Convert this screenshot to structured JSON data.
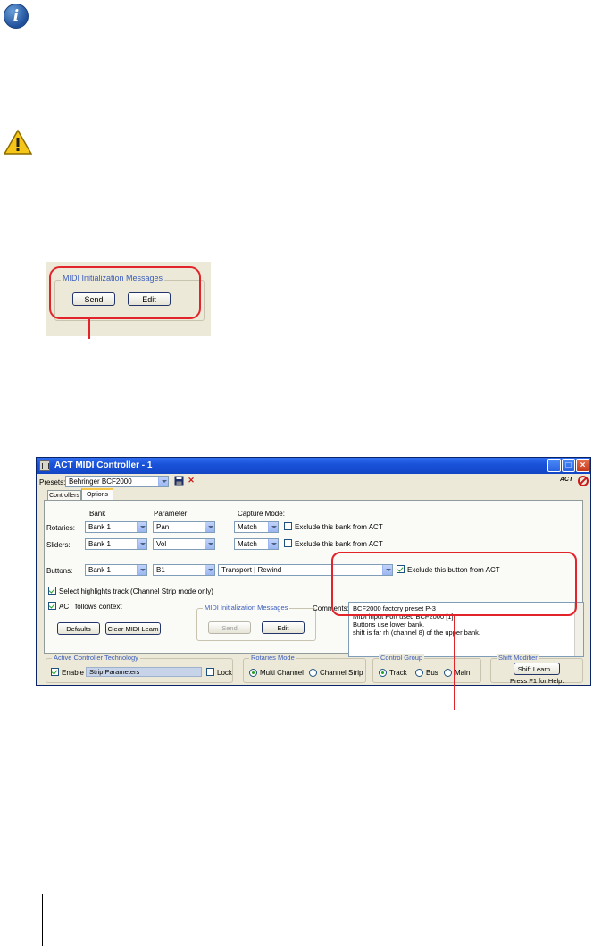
{
  "icons": {
    "info": "info-icon",
    "warning": "warning-icon"
  },
  "colors": {
    "callout": "#e2232a",
    "titlebar": "#1952d9",
    "window_bg": "#ece9d8",
    "group_label": "#3a5dbd"
  },
  "crop": {
    "group_label": "MIDI Initialization Messages",
    "send_label": "Send",
    "edit_label": "Edit"
  },
  "window": {
    "title": "ACT MIDI Controller - 1",
    "presets_label": "Presets:",
    "preset_value": "Behringer BCF2000",
    "tabs": [
      "Controllers",
      "Options"
    ],
    "active_tab": "Options",
    "col_bank": "Bank",
    "col_parameter": "Parameter",
    "col_capture": "Capture Mode:",
    "rows": [
      {
        "label": "Rotaries:",
        "bank": "Bank 1",
        "param": "Pan",
        "capture": "Match",
        "exclude": "Exclude this bank from ACT"
      },
      {
        "label": "Sliders:",
        "bank": "Bank 1",
        "param": "Vol",
        "capture": "Match",
        "exclude": "Exclude this bank from ACT"
      }
    ],
    "buttons_row": {
      "label": "Buttons:",
      "bank": "Bank 1",
      "param": "B1",
      "action": "Transport | Rewind",
      "exclude": "Exclude this button from ACT"
    },
    "select_highlights": "Select highlights track (Channel Strip mode only)",
    "act_follows": "ACT follows context",
    "defaults_label": "Defaults",
    "clear_midi_label": "Clear MIDI Learn",
    "midi_group": {
      "label": "MIDI Initialization Messages",
      "send": "Send",
      "edit": "Edit"
    },
    "comments_label": "Comments:",
    "comments": [
      "BCF2000 factory preset P-3",
      "MIDI input Port used BCF2000 [1]",
      "Buttons use lower bank.",
      "shift is far rh (channel 8) of the upper bank."
    ],
    "act_group": {
      "label": "Active Controller Technology",
      "enable": "Enable",
      "field": "Strip Parameters",
      "lock": "Lock"
    },
    "rotaries_group": {
      "label": "Rotaries Mode",
      "multi": "Multi Channel",
      "strip": "Channel Strip"
    },
    "control_group": {
      "label": "Control Group",
      "track": "Track",
      "bus": "Bus",
      "main": "Main"
    },
    "shift_group": {
      "label": "Shift Modifier",
      "button": "Shift Learn..."
    },
    "help_text": "Press F1 for Help.",
    "act_logo": "ACT"
  }
}
